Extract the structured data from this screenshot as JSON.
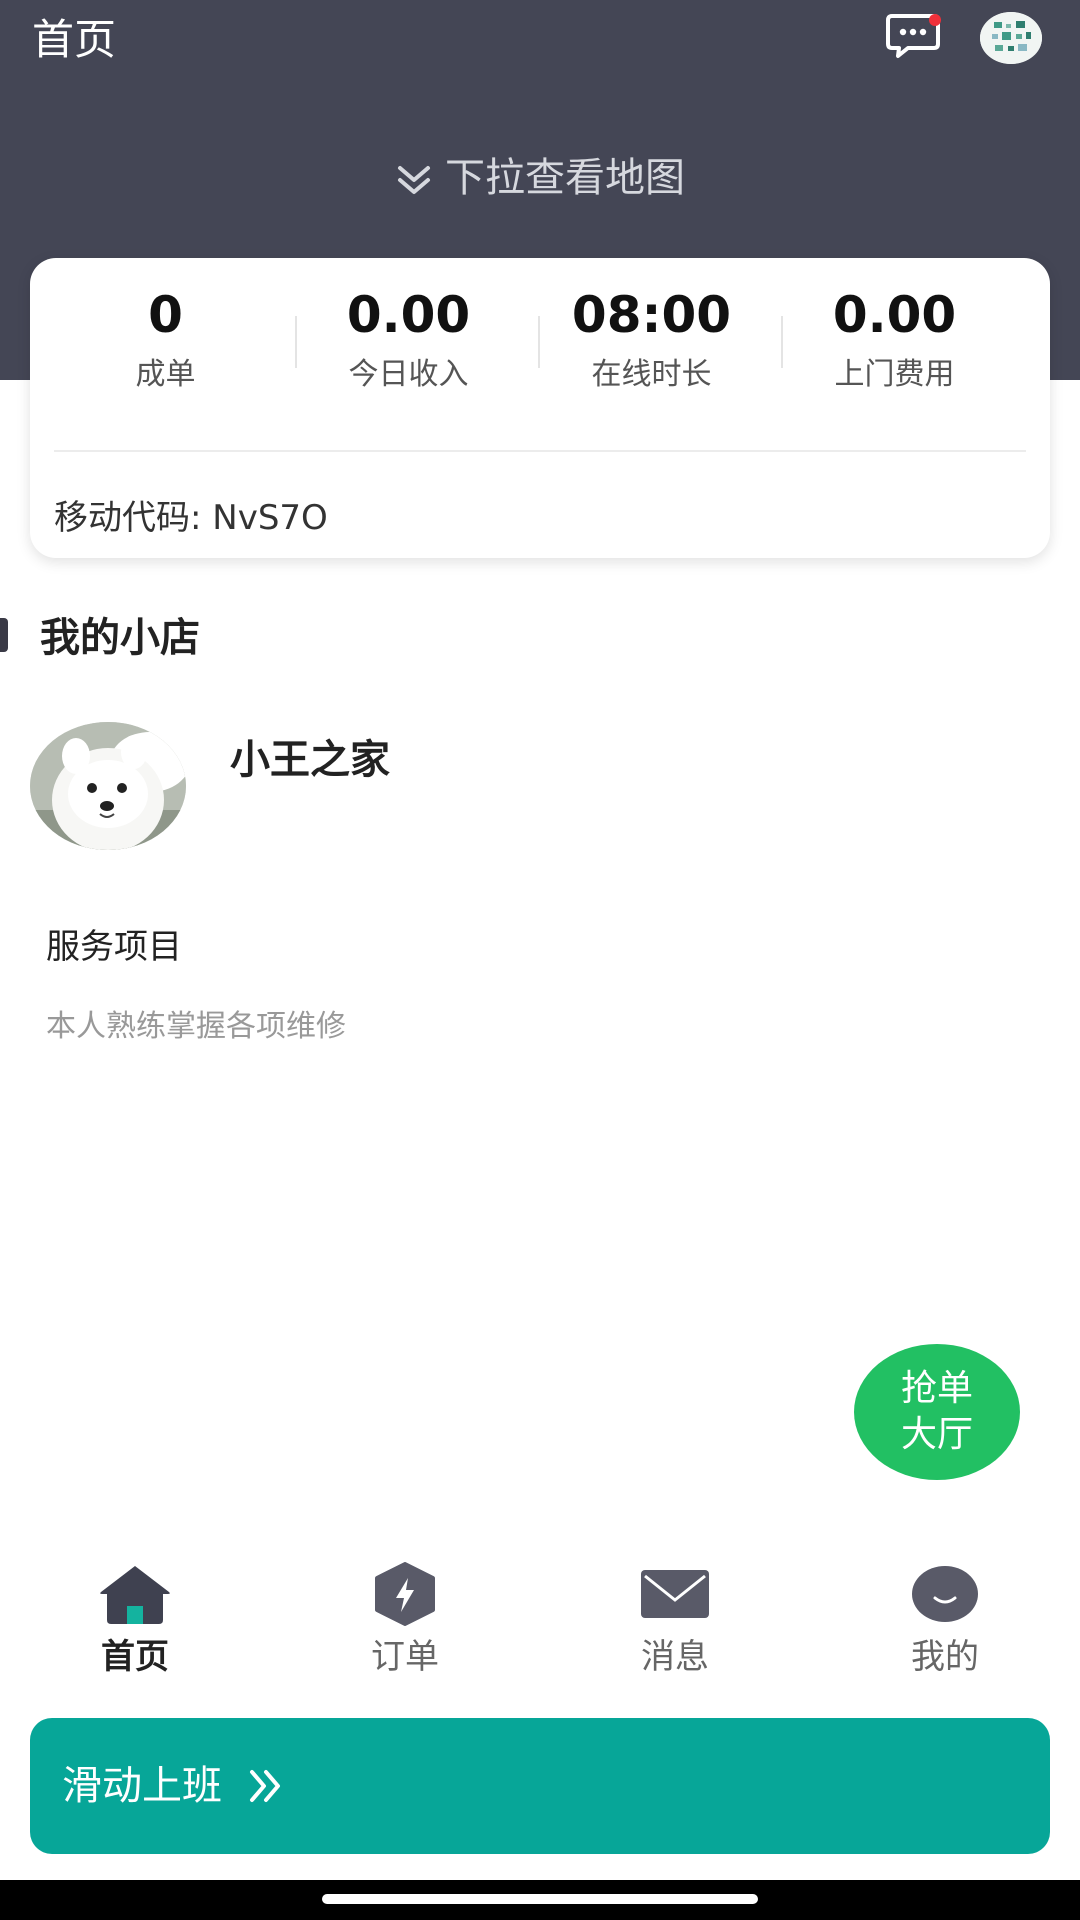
{
  "header": {
    "title": "首页",
    "pull_hint": "下拉查看地图"
  },
  "stats": [
    {
      "value": "0",
      "label": "成单"
    },
    {
      "value": "0.00",
      "label": "今日收入"
    },
    {
      "value": "08:00",
      "label": "在线时长"
    },
    {
      "value": "0.00",
      "label": "上门费用"
    }
  ],
  "mobile_code": "移动代码: NvS7O",
  "shop": {
    "section_title": "我的小店",
    "name": "小王之家",
    "service_title": "服务项目",
    "service_desc": "本人熟练掌握各项维修"
  },
  "grab_button": {
    "line1": "抢单",
    "line2": "大厅"
  },
  "tabs": [
    {
      "label": "首页",
      "icon": "home-icon",
      "active": true
    },
    {
      "label": "订单",
      "icon": "order-lightning-icon",
      "active": false
    },
    {
      "label": "消息",
      "icon": "envelope-icon",
      "active": false
    },
    {
      "label": "我的",
      "icon": "smiley-icon",
      "active": false
    }
  ],
  "slide_bar": {
    "label": "滑动上班"
  },
  "colors": {
    "header_bg": "#444655",
    "accent_teal": "#07a698",
    "grab_green": "#22c063",
    "notification_red": "#f0303a",
    "tab_icon": "#595a68"
  }
}
